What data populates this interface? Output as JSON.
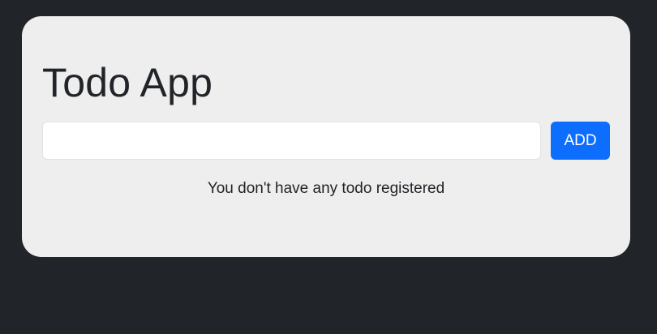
{
  "app": {
    "title": "Todo App"
  },
  "form": {
    "input_value": "",
    "input_placeholder": "",
    "add_label": "ADD"
  },
  "list": {
    "empty_message": "You don't have any todo registered"
  },
  "colors": {
    "page_background": "#212529",
    "card_background": "#eeeeee",
    "accent": "#0d6efd",
    "text": "#212529"
  }
}
